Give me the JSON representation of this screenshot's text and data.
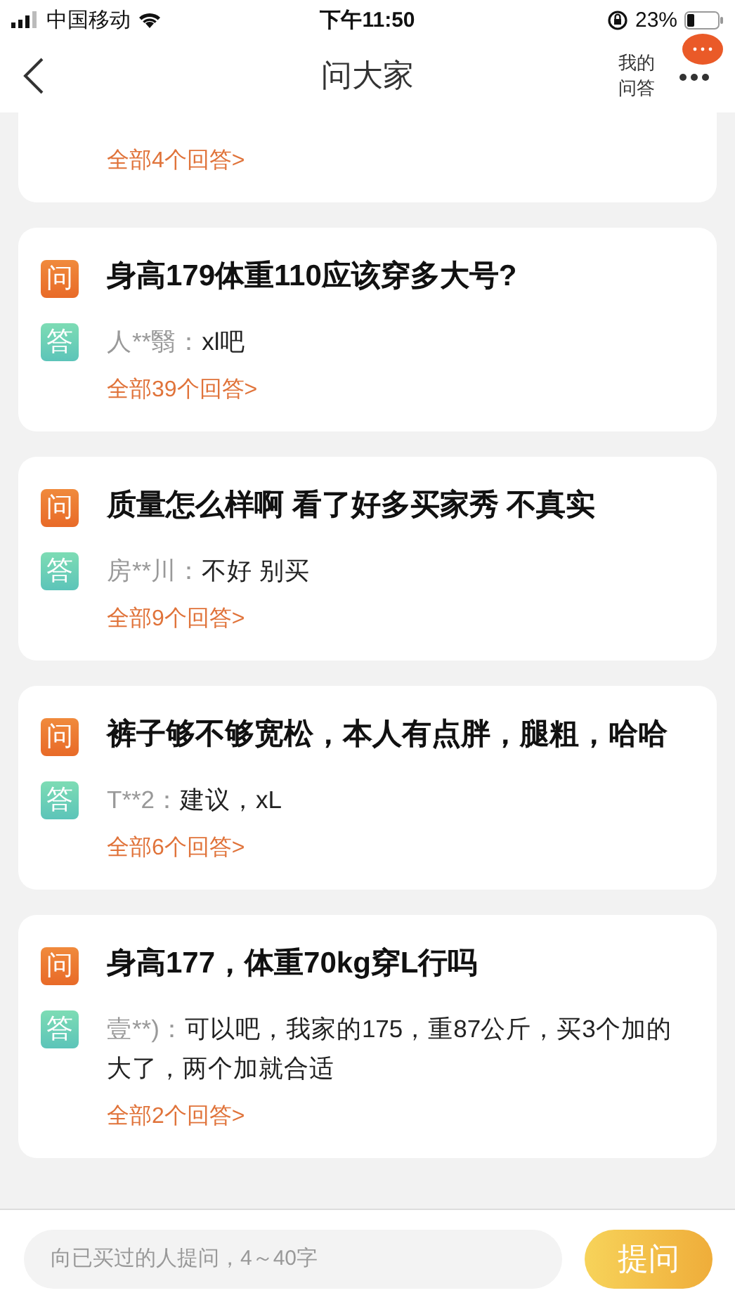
{
  "status_bar": {
    "carrier": "中国移动",
    "time": "下午11:50",
    "battery": "23%"
  },
  "nav": {
    "title": "问大家",
    "my_qa": "我的问答"
  },
  "cards": [
    {
      "link": "全部4个回答>"
    },
    {
      "q_mark": "问",
      "question": "身高179体重110应该穿多大号?",
      "a_mark": "答",
      "answerer": "人**翳：",
      "answer": "xl吧",
      "link": "全部39个回答>"
    },
    {
      "q_mark": "问",
      "question": "质量怎么样啊  看了好多买家秀 不真实",
      "a_mark": "答",
      "answerer": "房**川：",
      "answer": "不好 别买",
      "link": "全部9个回答>"
    },
    {
      "q_mark": "问",
      "question": "裤子够不够宽松，本人有点胖，腿粗，哈哈",
      "a_mark": "答",
      "answerer": "T**2：",
      "answer": "建议，xL",
      "link": "全部6个回答>"
    },
    {
      "q_mark": "问",
      "question": "身高177，体重70kg穿L行吗",
      "a_mark": "答",
      "answerer": "壹**)：",
      "answer": "可以吧，我家的175，重87公斤，买3个加的大了，两个加就合适",
      "link": "全部2个回答>"
    }
  ],
  "ask_bar": {
    "placeholder": "向已买过的人提问，4～40字",
    "button": "提问"
  }
}
